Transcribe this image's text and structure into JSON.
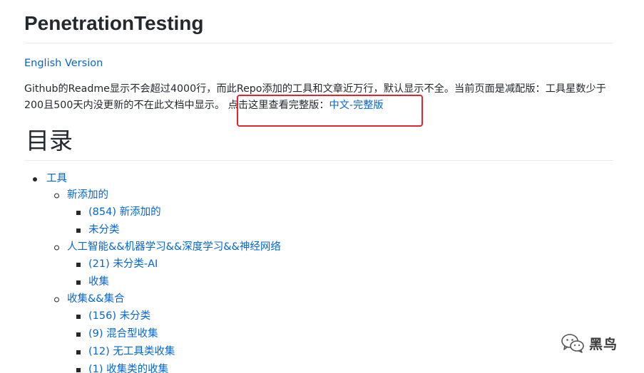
{
  "title": "PenetrationTesting",
  "english_link": "English Version",
  "intro": {
    "text_before": "Github的Readme显示不会超过4000行，而此Repo添加的工具和文章近万行，默认显示不全。当前页面是减配版：工具星数少于200且500天内没更新的不在此文档中显示。 点击这里查看完整版：",
    "full_link": "中文-完整版"
  },
  "toc_heading": "目录",
  "toc": {
    "tools": "工具",
    "new_added": "新添加的",
    "new_added_count": "(854) 新添加的",
    "uncategorized": "未分类",
    "ai": "人工智能&&机器学习&&深度学习&&神经网络",
    "ai_uncategorized": "(21) 未分类-AI",
    "ai_collection": "收集",
    "collections": "收集&&集合",
    "col_uncategorized": "(156) 未分类",
    "col_mixed": "(9) 混合型收集",
    "col_no_tools": "(12) 无工具类收集",
    "col_collection_type": "(1) 收集类的收集"
  },
  "watermark": {
    "text": "黑鸟",
    "icon": "wechat-icon"
  },
  "colors": {
    "link": "#0366d6",
    "text": "#24292e",
    "highlight": "#e0262c"
  }
}
